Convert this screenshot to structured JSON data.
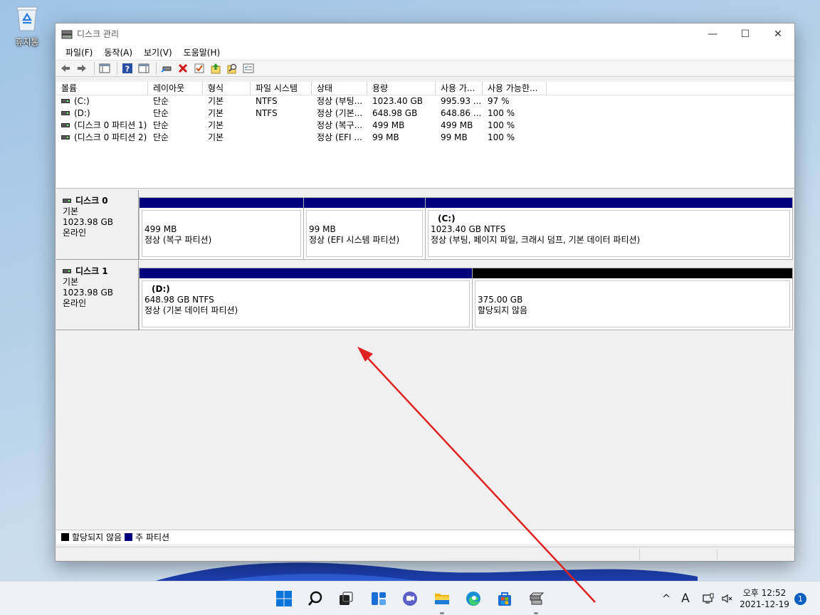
{
  "desktop": {
    "recycle_bin_label": "휴지통"
  },
  "window": {
    "title": "디스크 관리",
    "controls": {
      "minimize": "—",
      "maximize": "☐",
      "close": "✕"
    }
  },
  "menu": [
    "파일(F)",
    "동작(A)",
    "보기(V)",
    "도움말(H)"
  ],
  "toolbar_icons": [
    "back-icon",
    "forward-icon",
    "show-hide-console-tree-icon",
    "help-icon",
    "properties-pane-icon",
    "connect-drive-icon",
    "delete-icon",
    "check-icon",
    "export-icon",
    "search-icon",
    "list-icon"
  ],
  "volume_list": {
    "columns": [
      "볼륨",
      "레이아웃",
      "형식",
      "파일 시스템",
      "상태",
      "용량",
      "사용 가...",
      "사용 가능한..."
    ],
    "rows": [
      [
        "(C:)",
        "단순",
        "기본",
        "NTFS",
        "정상 (부팅...",
        "1023.40 GB",
        "995.93 ...",
        "97 %"
      ],
      [
        "(D:)",
        "단순",
        "기본",
        "NTFS",
        "정상 (기본...",
        "648.98 GB",
        "648.86 ...",
        "100 %"
      ],
      [
        "(디스크 0 파티션 1)",
        "단순",
        "기본",
        "",
        "정상 (복구...",
        "499 MB",
        "499 MB",
        "100 %"
      ],
      [
        "(디스크 0 파티션 2)",
        "단순",
        "기본",
        "",
        "정상 (EFI ...",
        "99 MB",
        "99 MB",
        "100 %"
      ]
    ]
  },
  "disks": [
    {
      "name": "디스크 0",
      "type": "기본",
      "size": "1023.98 GB",
      "status": "온라인",
      "partitions": [
        {
          "name": "",
          "size": "499 MB",
          "status": "정상 (복구 파티션)"
        },
        {
          "name": "",
          "size": "99 MB",
          "status": "정상 (EFI 시스템 파티션)"
        },
        {
          "name": "(C:)",
          "size": "1023.40 GB NTFS",
          "status": "정상 (부팅, 페이지 파일, 크래시 덤프, 기본 데이터 파티션)"
        }
      ]
    },
    {
      "name": "디스크 1",
      "type": "기본",
      "size": "1023.98 GB",
      "status": "온라인",
      "partitions": [
        {
          "name": "(D:)",
          "size": "648.98 GB NTFS",
          "status": "정상 (기본 데이터 파티션)"
        },
        {
          "name": "",
          "size": "375.00 GB",
          "status": "할당되지 않음"
        }
      ]
    }
  ],
  "legend": {
    "unallocated": "할당되지 않음",
    "primary": "주 파티션"
  },
  "colors": {
    "primary_partition": "#00007f",
    "unallocated": "#000000",
    "annotation_arrow": "#e02020"
  },
  "taskbar": {
    "apps": [
      "windows-start-icon",
      "search-icon",
      "task-view-icon",
      "widgets-icon",
      "chat-icon",
      "file-explorer-icon",
      "edge-icon",
      "store-icon",
      "disk-management-icon"
    ],
    "tray": {
      "chevron": "^",
      "ime": "A"
    },
    "clock": {
      "time": "오후 12:52",
      "date": "2021-12-19"
    },
    "notification_count": "1"
  }
}
